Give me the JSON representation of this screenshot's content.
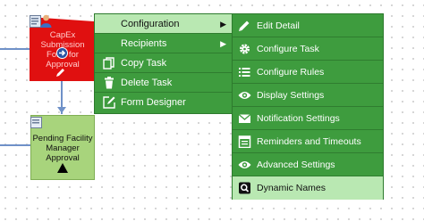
{
  "canvas": {
    "red_node_text": [
      "CapEx",
      "Submission",
      "Form for",
      "Approval"
    ],
    "green_node_text": [
      "Pending Facility",
      "Manager",
      "Approval"
    ]
  },
  "context_menu": {
    "items": [
      {
        "label": "Configuration",
        "icon": "none",
        "submenu": true,
        "active": true
      },
      {
        "label": "Recipients",
        "icon": "none",
        "submenu": true,
        "active": false
      },
      {
        "label": "Copy Task",
        "icon": "copy-icon",
        "submenu": false,
        "active": false
      },
      {
        "label": "Delete Task",
        "icon": "trash-icon",
        "submenu": false,
        "active": false
      },
      {
        "label": "Form Designer",
        "icon": "edit-box-icon",
        "submenu": false,
        "active": false
      }
    ]
  },
  "submenu": {
    "items": [
      {
        "label": "Edit Detail",
        "icon": "pencil-icon"
      },
      {
        "label": "Configure Task",
        "icon": "gear-icon"
      },
      {
        "label": "Configure Rules",
        "icon": "list-icon"
      },
      {
        "label": "Display Settings",
        "icon": "eye-icon"
      },
      {
        "label": "Notification Settings",
        "icon": "envelope-icon"
      },
      {
        "label": "Reminders and Timeouts",
        "icon": "calendar-icon"
      },
      {
        "label": "Advanced Settings",
        "icon": "eye-icon"
      },
      {
        "label": "Dynamic Names",
        "icon": "search-icon",
        "active": true
      }
    ]
  },
  "colors": {
    "menu_bg": "#3e9c3e",
    "menu_active": "#b9e8b2",
    "node_red": "#e01010",
    "node_green": "#a8d47c"
  }
}
